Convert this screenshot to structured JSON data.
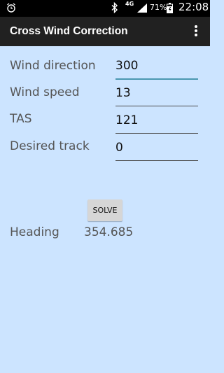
{
  "status_bar": {
    "network": "4G",
    "battery_percent": "71%",
    "time": "22:08"
  },
  "app_bar": {
    "title": "Cross Wind Correction"
  },
  "form": {
    "wind_direction": {
      "label": "Wind direction",
      "value": "300"
    },
    "wind_speed": {
      "label": "Wind speed",
      "value": "13"
    },
    "tas": {
      "label": "TAS",
      "value": "121"
    },
    "desired_track": {
      "label": "Desired track",
      "value": "0"
    }
  },
  "solve_label": "SOLVE",
  "result": {
    "label": "Heading",
    "value": "354.685"
  },
  "colors": {
    "background": "#cce4ff",
    "app_bar": "#212121",
    "focused_underline": "#4a97b0"
  }
}
